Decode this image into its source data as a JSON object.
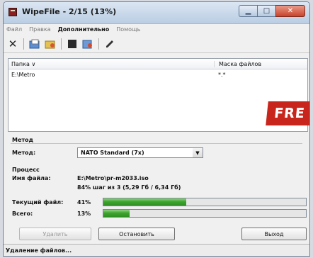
{
  "window": {
    "title": "WipeFile - 2/15 (13%)"
  },
  "menu": [
    "Файл",
    "Правка",
    "Дополнительно",
    "Помощь"
  ],
  "list": {
    "col_folder": "Папка",
    "col_mask": "Маска файлов",
    "rows": [
      {
        "folder": "E:\\Metro",
        "mask": "*.*"
      }
    ]
  },
  "banner": "FRE",
  "method": {
    "section": "Метод",
    "label": "Метод:",
    "value": "NATO Standard (7x)"
  },
  "process": {
    "section": "Процесс",
    "filename_label": "Имя файла:",
    "filename": "E:\\Metro\\pr-m2033.iso",
    "step": "84% шаг из 3 (5,29 Гб / 6,34 Гб)",
    "current_label": "Текущий файл:",
    "current_pct": "41%",
    "current_value": 0.41,
    "total_label": "Всего:",
    "total_pct": "13%",
    "total_value": 0.13
  },
  "buttons": {
    "delete": "Удалить",
    "stop": "Остановить",
    "exit": "Выход"
  },
  "status": "Удаление файлов..."
}
